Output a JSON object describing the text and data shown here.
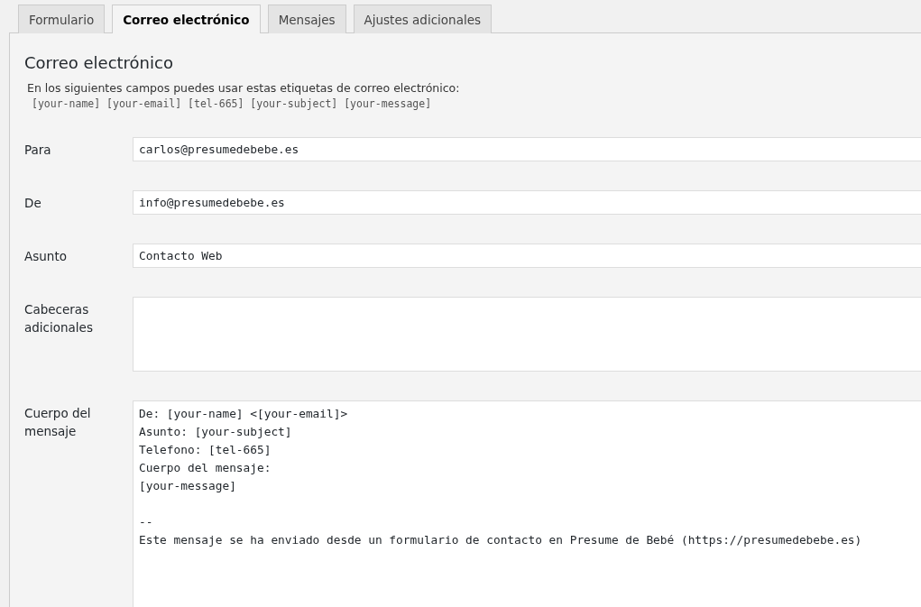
{
  "tabs": [
    {
      "label": "Formulario",
      "selected": false
    },
    {
      "label": "Correo electrónico",
      "selected": true
    },
    {
      "label": "Mensajes",
      "selected": false
    },
    {
      "label": "Ajustes adicionales",
      "selected": false
    }
  ],
  "section": {
    "title": "Correo electrónico",
    "description": "En los siguientes campos puedes usar estas etiquetas de correo electrónico:",
    "tags": "[your-name] [your-email] [tel-665] [your-subject] [your-message]"
  },
  "fields": [
    {
      "kind": "input",
      "label": "Para",
      "value": "carlos@presumedebebe.es"
    },
    {
      "kind": "input",
      "label": "De",
      "value": "info@presumedebebe.es"
    },
    {
      "kind": "input",
      "label": "Asunto",
      "value": "Contacto Web"
    },
    {
      "kind": "textarea",
      "label": "Cabeceras adicionales"
    },
    {
      "kind": "bodyarea",
      "label": "Cuerpo del mensaje",
      "value": "De: [your-name] <[your-email]>\nAsunto: [your-subject]\nTelefono: [tel-665]\nCuerpo del mensaje:\n[your-message]\n\n--\nEste mensaje se ha enviado desde un formulario de contacto en Presume de Bebé (https://presumedebebe.es)"
    }
  ]
}
